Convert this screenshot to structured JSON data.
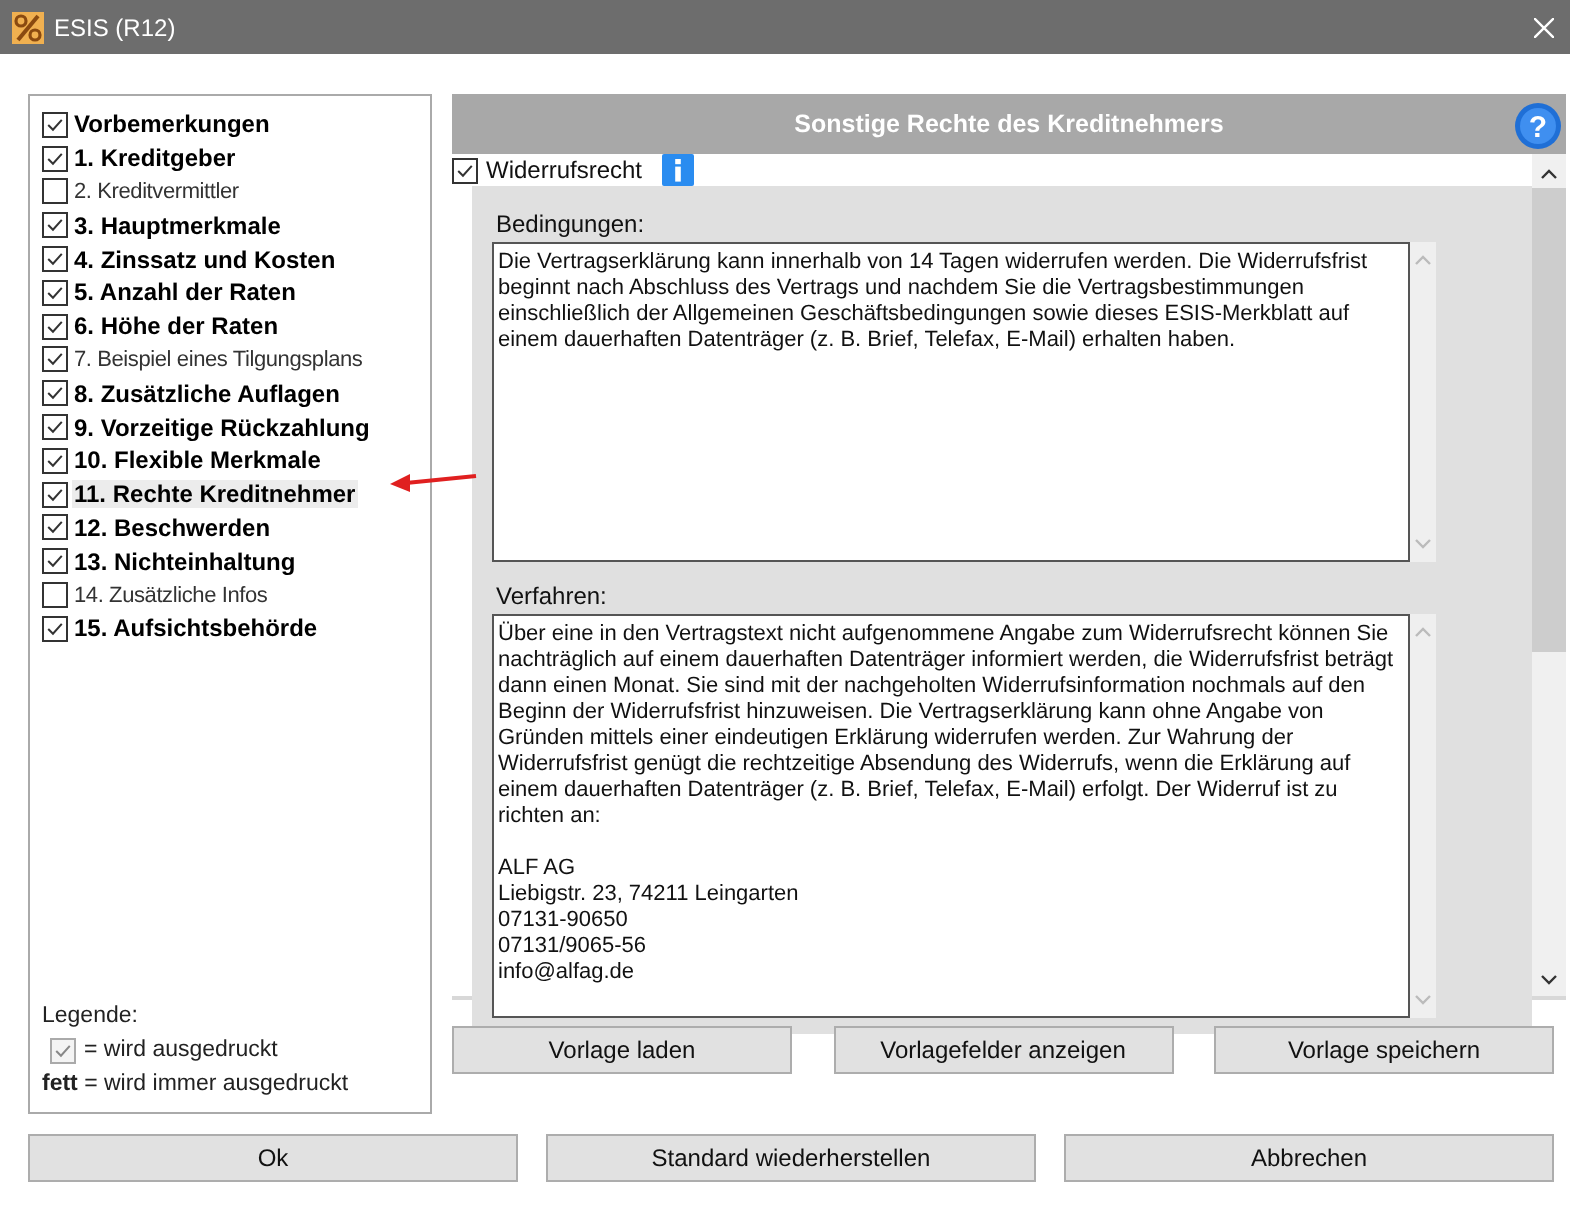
{
  "window": {
    "title": "ESIS (R12)"
  },
  "sections": [
    {
      "label": "Vorbemerkungen",
      "checked": true,
      "bold": true,
      "selected": false
    },
    {
      "label": "1. Kreditgeber",
      "checked": true,
      "bold": true,
      "selected": false
    },
    {
      "label": "2. Kreditvermittler",
      "checked": false,
      "bold": false,
      "selected": false
    },
    {
      "label": "3. Hauptmerkmale",
      "checked": true,
      "bold": true,
      "selected": false
    },
    {
      "label": "4. Zinssatz und Kosten",
      "checked": true,
      "bold": true,
      "selected": false
    },
    {
      "label": "5. Anzahl der Raten",
      "checked": true,
      "bold": true,
      "selected": false
    },
    {
      "label": "6. Höhe der Raten",
      "checked": true,
      "bold": true,
      "selected": false
    },
    {
      "label": "7. Beispiel eines Tilgungsplans",
      "checked": true,
      "bold": false,
      "selected": false
    },
    {
      "label": "8. Zusätzliche Auflagen",
      "checked": true,
      "bold": true,
      "selected": false
    },
    {
      "label": "9. Vorzeitige Rückzahlung",
      "checked": true,
      "bold": true,
      "selected": false
    },
    {
      "label": "10. Flexible Merkmale",
      "checked": true,
      "bold": true,
      "selected": false
    },
    {
      "label": "11. Rechte Kreditnehmer",
      "checked": true,
      "bold": true,
      "selected": true
    },
    {
      "label": "12. Beschwerden",
      "checked": true,
      "bold": true,
      "selected": false
    },
    {
      "label": "13. Nichteinhaltung",
      "checked": true,
      "bold": true,
      "selected": false
    },
    {
      "label": "14. Zusätzliche Infos",
      "checked": false,
      "bold": false,
      "selected": false
    },
    {
      "label": "15. Aufsichtsbehörde",
      "checked": true,
      "bold": true,
      "selected": false
    }
  ],
  "legend": {
    "title": "Legende:",
    "checked_note": {
      "checked": true,
      "text": "= wird ausgedruckt"
    },
    "bold_note": "**fett** = wird immer ausgedruckt"
  },
  "panel": {
    "title": "Sonstige Rechte des Kreditnehmers",
    "help_symbol": "?",
    "option": {
      "label": "Widerrufsrecht",
      "checked": true
    },
    "fields": [
      {
        "label": "Bedingungen:",
        "value": "Die Vertragserklärung kann innerhalb von 14 Tagen widerrufen werden. Die Widerrufsfrist beginnt nach Abschluss des Vertrags und nachdem Sie die Vertragsbestimmungen einschließlich der Allgemeinen Geschäftsbedingungen sowie dieses ESIS-Merkblatt auf einem dauerhaften Datenträger (z. B. Brief, Telefax, E-Mail) erhalten haben."
      },
      {
        "label": "Verfahren:",
        "value": "Über eine in den Vertragstext nicht aufgenommene Angabe zum Widerrufsrecht können Sie nachträglich auf einem dauerhaften Datenträger informiert werden, die Widerrufsfrist beträgt dann einen Monat. Sie sind mit der nachgeholten Widerrufsinformation nochmals auf den Beginn der Widerrufsfrist hinzuweisen. Die Vertragserklärung kann ohne Angabe von Gründen mittels einer eindeutigen Erklärung widerrufen werden. Zur Wahrung der Widerrufsfrist genügt die rechtzeitige Absendung des Widerrufs, wenn die Erklärung auf einem dauerhaften Datenträger (z. B. Brief, Telefax, E-Mail) erfolgt. Der Widerruf ist zu richten an:\n\nALF AG\nLiebigstr. 23, 74211 Leingarten\n07131-90650\n07131/9065-56\ninfo@alfag.de"
      }
    ]
  },
  "template_buttons": [
    "Vorlage laden",
    "Vorlagefelder anzeigen",
    "Vorlage speichern"
  ],
  "buttons": [
    "Ok",
    "Standard wiederherstellen",
    "Abbrechen"
  ]
}
